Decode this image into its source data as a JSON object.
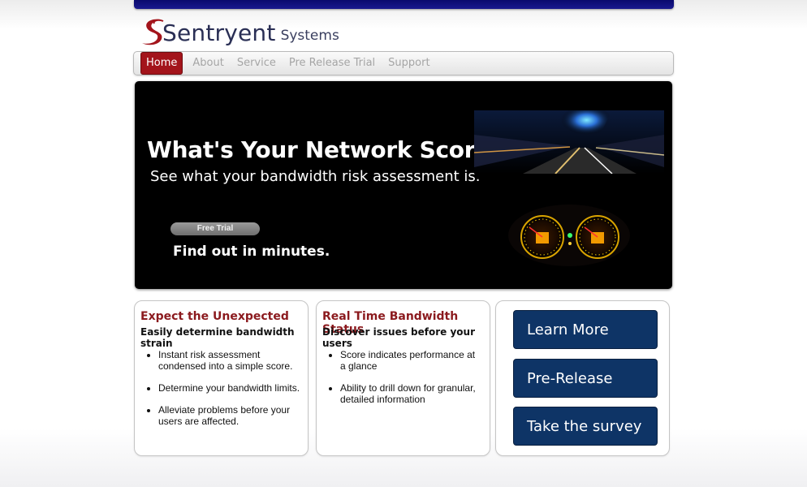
{
  "brand": {
    "name": "Sentryent",
    "sub": "Systems"
  },
  "nav": {
    "items": [
      {
        "label": "Home"
      },
      {
        "label": "About"
      },
      {
        "label": "Service"
      },
      {
        "label": "Pre Release Trial"
      },
      {
        "label": "Support"
      }
    ]
  },
  "hero": {
    "title": "What's Your Network Score?",
    "subtitle": "See what your bandwidth risk assessment is.",
    "button_label": "Free Trial",
    "tagline": "Find out in minutes."
  },
  "features": [
    {
      "title": "Expect the Unexpected",
      "subtitle": "Easily determine bandwidth strain",
      "bullets": [
        "Instant risk assessment condensed into a simple score.",
        "Determine your bandwidth limits.",
        "Alleviate problems before your users are affected."
      ]
    },
    {
      "title": "Real Time Bandwidth Status",
      "subtitle": "Discover issues before your users",
      "bullets": [
        "Score indicates performance at a glance",
        "Ability to drill down for granular, detailed information"
      ]
    }
  ],
  "cta": {
    "learn_more": "Learn More",
    "pre_release": "Pre-Release",
    "survey": "Take the survey"
  },
  "colors": {
    "brand_red": "#a3141b",
    "heading_red": "#8b1a1e",
    "cta_blue": "#0e3466",
    "top_bar": "#0a0a6e"
  },
  "icons": {
    "logo": "sentryent-swoosh-logo"
  }
}
